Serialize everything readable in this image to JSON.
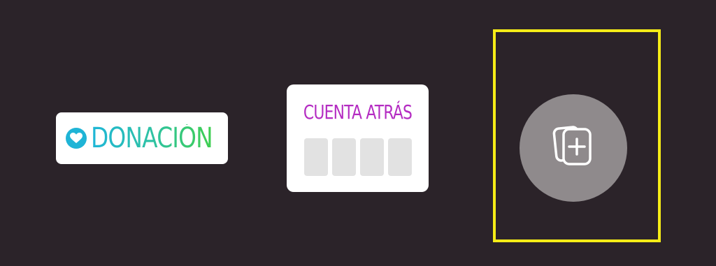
{
  "stickers": {
    "donation": {
      "label": "DONACIÓN",
      "icon": "heart-icon"
    },
    "countdown": {
      "title": "CUENTA ATRÁS",
      "slot_count": 4
    },
    "add_button": {
      "icon": "add-sticker-icon"
    }
  },
  "colors": {
    "background": "#2b2329",
    "highlight": "#f5ec17",
    "donation_gradient_start": "#1eb6d8",
    "donation_gradient_end": "#3fcf4f",
    "countdown_title": "#b42cc2",
    "add_button": "#8f8a8c"
  }
}
